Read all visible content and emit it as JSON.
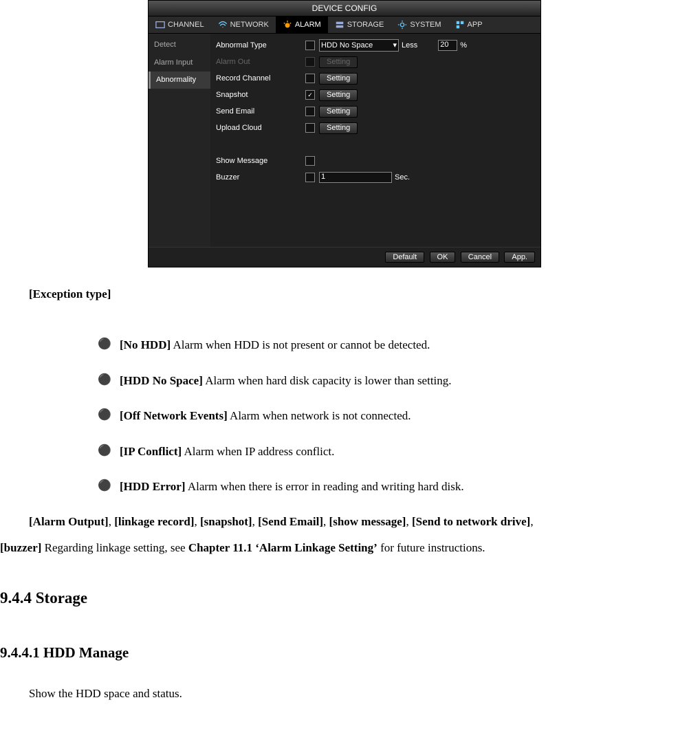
{
  "ui": {
    "title": "DEVICE CONFIG",
    "tabs": {
      "channel": "CHANNEL",
      "network": "NETWORK",
      "alarm": "ALARM",
      "storage": "STORAGE",
      "system": "SYSTEM",
      "app": "APP"
    },
    "sidebar": {
      "detect": "Detect",
      "alarm_input": "Alarm Input",
      "abnormality": "Abnormality"
    },
    "rows": {
      "abnormal_type": "Abnormal Type",
      "abnormal_type_value": "HDD No Space",
      "less_label": "Less",
      "less_value": "20",
      "pct": "%",
      "alarm_out": "Alarm Out",
      "record_channel": "Record Channel",
      "snapshot": "Snapshot",
      "send_email": "Send Email",
      "upload_cloud": "Upload Cloud",
      "show_message": "Show Message",
      "buzzer": "Buzzer",
      "buzzer_value": "1",
      "sec": "Sec.",
      "setting": "Setting"
    },
    "footer": {
      "default": "Default",
      "ok": "OK",
      "cancel": "Cancel",
      "app": "App."
    }
  },
  "doc": {
    "exception_type_h": "[Exception type]",
    "b1_bold": "[No HDD]",
    "b1_text": " Alarm when HDD is not present or cannot be detected.",
    "b2_bold": "[HDD No Space]",
    "b2_text": " Alarm when hard disk capacity is lower than setting.",
    "b3_bold": "[Off    Network Events]",
    "b3_text": " Alarm when network is not connected.",
    "b4_bold": "[IP Conflict]",
    "b4_text": " Alarm when IP address conflict.",
    "b5_bold": "[HDD Error]",
    "b5_text": " Alarm when there is error in reading and writing hard disk.",
    "para_bold1": "[Alarm Output]",
    "para_sep": ", ",
    "para_bold2": "[linkage record]",
    "para_bold3": "[snapshot]",
    "para_bold4": "[Send Email]",
    "para_bold5": "[show message]",
    "para_bold6": "[Send to network drive]",
    "para_bold7": "[buzzer]",
    "para_mid": "  Regarding linkage setting, see ",
    "para_bold8": "Chapter 11.1 ‘Alarm Linkage Setting’",
    "para_end": " for future instructions.",
    "h_storage": "9.4.4   Storage",
    "h_hdd": "9.4.4.1 HDD Manage",
    "hdd_text": "Show the HDD space and status."
  }
}
